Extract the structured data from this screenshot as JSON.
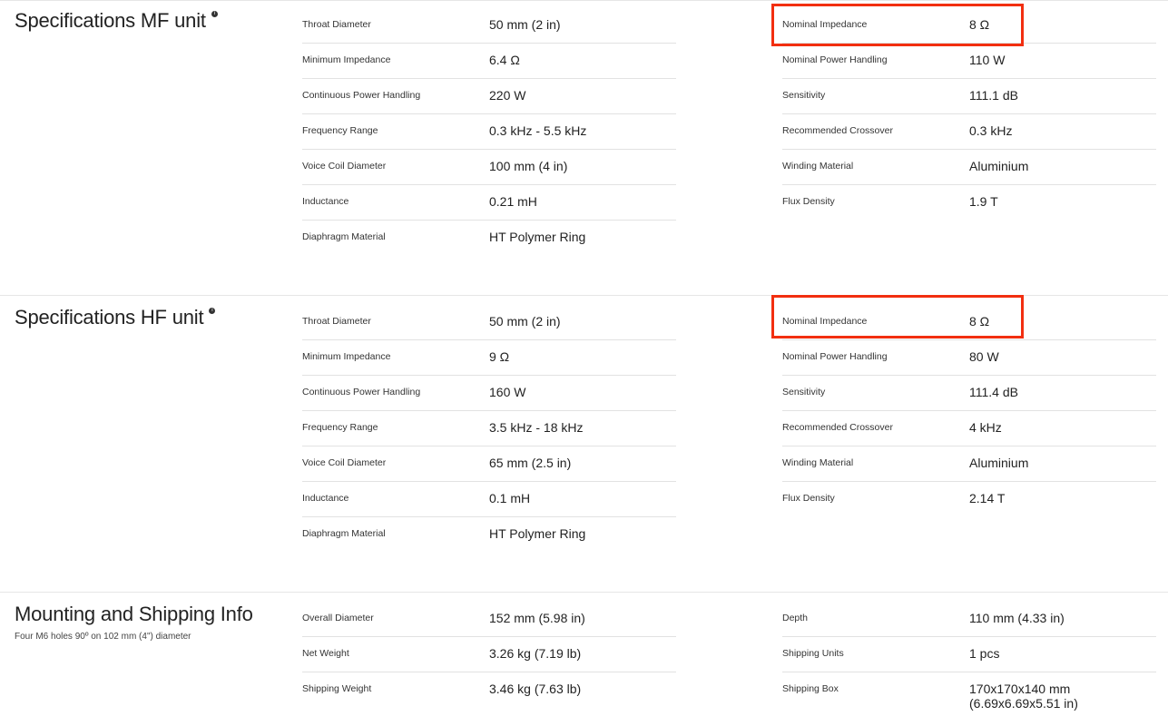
{
  "sections": [
    {
      "title": "Specifications MF unit",
      "subtitle": "",
      "left": [
        {
          "label": "Throat Diameter",
          "value": "50 mm (2 in)"
        },
        {
          "label": "Minimum Impedance",
          "value": "6.4 Ω"
        },
        {
          "label": "Continuous Power Handling",
          "value": "220 W"
        },
        {
          "label": "Frequency Range",
          "value": "0.3 kHz - 5.5 kHz"
        },
        {
          "label": "Voice Coil Diameter",
          "value": "100 mm (4 in)"
        },
        {
          "label": "Inductance",
          "value": "0.21 mH"
        },
        {
          "label": "Diaphragm Material",
          "value": "HT Polymer Ring"
        }
      ],
      "right": [
        {
          "label": "Nominal Impedance",
          "value": "8 Ω"
        },
        {
          "label": "Nominal Power Handling",
          "value": "110 W"
        },
        {
          "label": "Sensitivity",
          "value": "111.1 dB"
        },
        {
          "label": "Recommended Crossover",
          "value": "0.3 kHz"
        },
        {
          "label": "Winding Material",
          "value": "Aluminium"
        },
        {
          "label": "Flux Density",
          "value": "1.9 T"
        }
      ]
    },
    {
      "title": "Specifications HF unit",
      "subtitle": "",
      "left": [
        {
          "label": "Throat Diameter",
          "value": "50 mm (2 in)"
        },
        {
          "label": "Minimum Impedance",
          "value": "9 Ω"
        },
        {
          "label": "Continuous Power Handling",
          "value": "160 W"
        },
        {
          "label": "Frequency Range",
          "value": "3.5 kHz - 18 kHz"
        },
        {
          "label": "Voice Coil Diameter",
          "value": "65 mm (2.5 in)"
        },
        {
          "label": "Inductance",
          "value": "0.1 mH"
        },
        {
          "label": "Diaphragm Material",
          "value": "HT Polymer Ring"
        }
      ],
      "right": [
        {
          "label": "Nominal Impedance",
          "value": "8 Ω"
        },
        {
          "label": "Nominal Power Handling",
          "value": "80 W"
        },
        {
          "label": "Sensitivity",
          "value": "111.4 dB"
        },
        {
          "label": "Recommended Crossover",
          "value": "4 kHz"
        },
        {
          "label": "Winding Material",
          "value": "Aluminium"
        },
        {
          "label": "Flux Density",
          "value": "2.14 T"
        }
      ]
    },
    {
      "title": "Mounting and Shipping Info",
      "subtitle": "Four M6 holes 90º on 102 mm (4\") diameter",
      "left": [
        {
          "label": "Overall Diameter",
          "value": "152 mm (5.98 in)"
        },
        {
          "label": "Net Weight",
          "value": "3.26 kg (7.19 lb)"
        },
        {
          "label": "Shipping Weight",
          "value": "3.46 kg (7.63 lb)"
        }
      ],
      "right": [
        {
          "label": "Depth",
          "value": "110 mm (4.33 in)"
        },
        {
          "label": "Shipping Units",
          "value": "1 pcs"
        },
        {
          "label": "Shipping Box",
          "value": "170x170x140 mm (6.69x6.69x5.51 in)"
        }
      ]
    }
  ],
  "info_icon": "info-icon",
  "highlight_color": "#f22f10"
}
